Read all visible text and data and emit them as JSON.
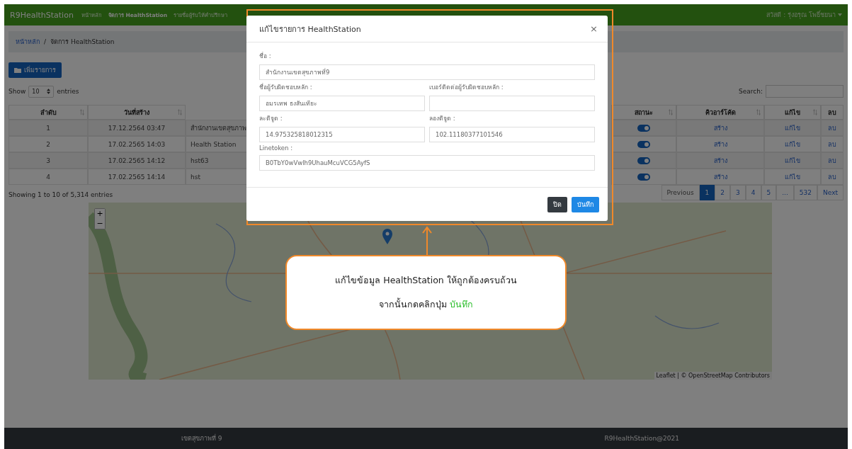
{
  "navbar": {
    "brand": "R9HealthStation",
    "items": [
      {
        "label": "หน้าหลัก",
        "selected": false
      },
      {
        "label": "จัดการ HealthStation",
        "selected": true
      },
      {
        "label": "รายชื่อผู้รับให้คำปรึกษา",
        "selected": false
      }
    ],
    "user": "สวัสดี : รุ่งอรุณ โพธิ์ชยนา"
  },
  "breadcrumb": {
    "separator": "/",
    "items": [
      {
        "label": "หน้าหลัก",
        "link": true
      },
      {
        "label": "จัดการ HealthStation",
        "link": false
      }
    ]
  },
  "add_button": "เพิ่มรายการ",
  "length_menu": {
    "before": "Show",
    "value": "10",
    "after": "entries"
  },
  "search_label": "Search:",
  "table": {
    "columns": [
      {
        "label": "ลำดับ",
        "sortable": true
      },
      {
        "label": "วันที่สร้าง",
        "sortable": true
      },
      {
        "label": "สถานะ",
        "sortable": true
      },
      {
        "label": "คิวอาร์โค้ด",
        "sortable": true
      },
      {
        "label": "แก้ไข",
        "sortable": true
      },
      {
        "label": "ลบ",
        "sortable": false
      }
    ],
    "rows": [
      {
        "no": "1",
        "created": "17.12.2564 03:47",
        "name": "สำนักงานเขตสุขภาพ",
        "on": true,
        "qr": "สร้าง",
        "edit": "แก้ไข",
        "delete": "ลบ"
      },
      {
        "no": "2",
        "created": "17.02.2565 14:03",
        "name": "Health Station",
        "on": true,
        "qr": "สร้าง",
        "edit": "แก้ไข",
        "delete": "ลบ"
      },
      {
        "no": "3",
        "created": "17.02.2565 14:12",
        "name": "hst63",
        "on": true,
        "qr": "สร้าง",
        "edit": "แก้ไข",
        "delete": "ลบ"
      },
      {
        "no": "4",
        "created": "17.02.2565 14:14",
        "name": "hst",
        "on": true,
        "qr": "สร้าง",
        "edit": "แก้ไข",
        "delete": "ลบ"
      }
    ]
  },
  "info": "Showing 1 to 10 of 5,314 entries",
  "pagination": [
    {
      "label": "Previous",
      "selected": false
    },
    {
      "label": "1",
      "selected": true
    },
    {
      "label": "2",
      "selected": false
    },
    {
      "label": "3",
      "selected": false
    },
    {
      "label": "4",
      "selected": false
    },
    {
      "label": "5",
      "selected": false
    },
    {
      "label": "...",
      "selected": false
    },
    {
      "label": "532",
      "selected": false
    },
    {
      "label": "Next",
      "selected": false
    }
  ],
  "map": {
    "zoom_in": "+",
    "zoom_out": "−",
    "attribution": "Leaflet | © OpenStreetMap Contributors"
  },
  "footer": {
    "left": "เขตสุขภาพที่ 9",
    "right": "R9HealthStation@2021"
  },
  "modal": {
    "title": "แก้ไขรายการ HealthStation",
    "close": "×",
    "field_rows": [
      [
        {
          "label": "ชื่อ :",
          "value": "สำนักงานเขตสุขภาพที่9"
        }
      ],
      [
        {
          "label": "ชื่อผู้รับผิดชอบหลัก :",
          "value": "อมรเทพ ธงสันเทียะ"
        },
        {
          "label": "เบอร์ติดต่อผู้รับผิดชอบหลัก :"
        }
      ],
      [
        {
          "label": "ละติจูด :",
          "value": "14.975325818012315"
        },
        {
          "label": "ลองติจูด :",
          "value": "102.11180377101546"
        }
      ],
      [
        {
          "label": "Linetoken :",
          "value": "B0TbY0wVwlh9UhauMcuVCG5AyfS"
        }
      ]
    ],
    "buttons": [
      {
        "label": "ปิด",
        "kind": "close"
      },
      {
        "label": "บันทึก",
        "kind": "save"
      }
    ]
  },
  "callout": {
    "line1": "แก้ไขข้อมูล HealthStation ให้ถูกต้องครบถ้วน",
    "line2": "จากนั้นกดคลิกปุ่ม",
    "highlight": "บันทึก"
  }
}
